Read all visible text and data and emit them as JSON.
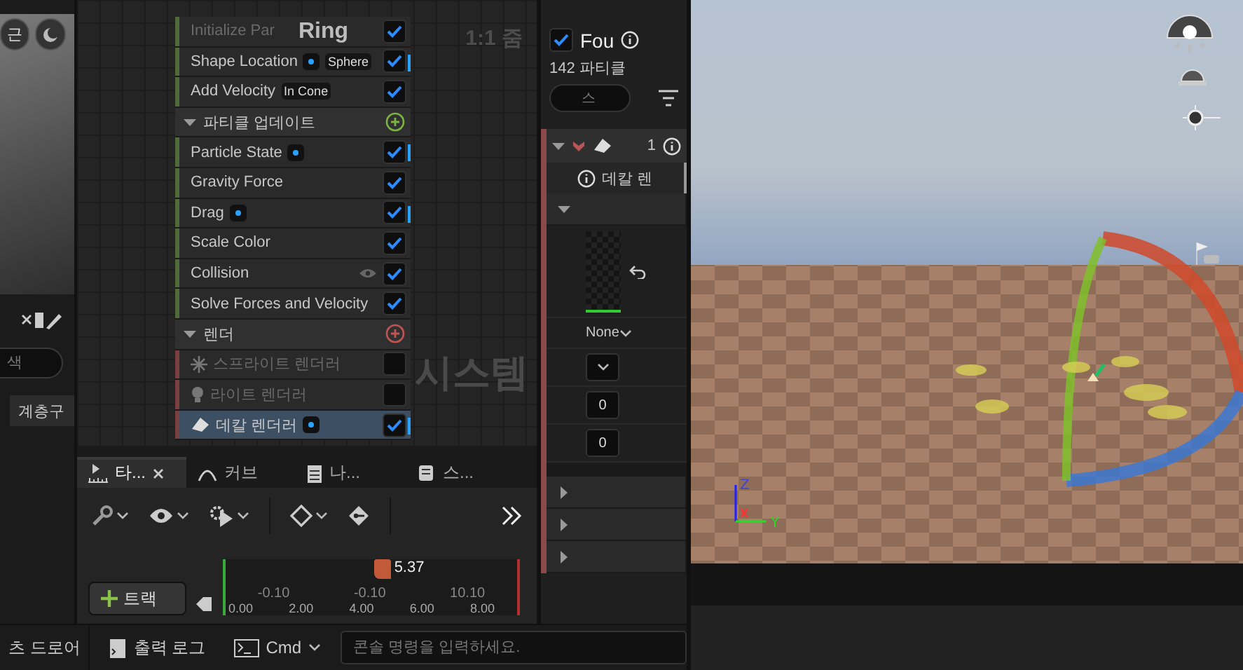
{
  "left_panel": {
    "view_button": "근",
    "search": {
      "placeholder": "색"
    },
    "hierarchy_button": "계층구"
  },
  "graph": {
    "title": "Ring",
    "zoom": "1:1 줌",
    "label": "시스템"
  },
  "module_stack": [
    {
      "kind": "module",
      "label": "Initialize Par",
      "dot": false,
      "checked": true,
      "disabled": true,
      "selected": false,
      "eye": false,
      "bar": false,
      "color": "#4f6b3a"
    },
    {
      "kind": "module",
      "label": "Shape Location",
      "dot": true,
      "tag": "Sphere",
      "checked": true,
      "disabled": false,
      "selected": false,
      "eye": false,
      "bar": true,
      "color": "#4f6b3a"
    },
    {
      "kind": "module",
      "label": "Add Velocity",
      "dot": false,
      "tag": "In Cone",
      "checked": true,
      "disabled": false,
      "selected": false,
      "eye": false,
      "bar": false,
      "color": "#4f6b3a"
    },
    {
      "kind": "header",
      "label": "파티클 업데이트",
      "expanded": true,
      "color": "#7cb342"
    },
    {
      "kind": "module",
      "label": "Particle State",
      "dot": true,
      "checked": true,
      "disabled": false,
      "selected": false,
      "eye": false,
      "bar": true,
      "color": "#4f6b3a"
    },
    {
      "kind": "module",
      "label": "Gravity Force",
      "dot": false,
      "checked": true,
      "disabled": false,
      "selected": false,
      "eye": false,
      "bar": false,
      "color": "#4f6b3a"
    },
    {
      "kind": "module",
      "label": "Drag",
      "dot": true,
      "checked": true,
      "disabled": false,
      "selected": false,
      "eye": false,
      "bar": true,
      "color": "#4f6b3a"
    },
    {
      "kind": "module",
      "label": "Scale Color",
      "dot": false,
      "checked": true,
      "disabled": false,
      "selected": false,
      "eye": false,
      "bar": false,
      "color": "#4f6b3a"
    },
    {
      "kind": "module",
      "label": "Collision",
      "dot": false,
      "checked": true,
      "disabled": false,
      "selected": false,
      "eye": true,
      "bar": false,
      "color": "#4f6b3a"
    },
    {
      "kind": "module",
      "label": "Solve Forces and Velocity",
      "dot": false,
      "checked": true,
      "disabled": false,
      "selected": false,
      "eye": false,
      "bar": false,
      "color": "#4f6b3a"
    },
    {
      "kind": "header",
      "label": "렌더",
      "expanded": true,
      "color": "#c25454"
    },
    {
      "kind": "sprite_renderer",
      "label": "스프라이트 렌더러",
      "dot": false,
      "checked": false,
      "disabled": true,
      "selected": false,
      "eye": false,
      "bar": false,
      "color": "#7a3f3f"
    },
    {
      "kind": "light_renderer",
      "label": "라이트 렌더러",
      "dot": false,
      "checked": false,
      "disabled": true,
      "selected": false,
      "eye": false,
      "bar": false,
      "color": "#7a3f3f"
    },
    {
      "kind": "decal_renderer",
      "label": "데칼 렌더러",
      "dot": true,
      "checked": true,
      "disabled": false,
      "selected": true,
      "eye": false,
      "bar": true,
      "color": "#7a3f3f"
    }
  ],
  "sequencer": {
    "tabs": [
      {
        "kind": "timeline",
        "label": "타...",
        "selected": true,
        "closable": true
      },
      {
        "kind": "curve",
        "label": "커브",
        "selected": false,
        "closable": false
      },
      {
        "kind": "notes",
        "label": "나...",
        "selected": false,
        "closable": false
      },
      {
        "kind": "script",
        "label": "스...",
        "selected": false,
        "closable": false
      }
    ],
    "add_track": "트랙",
    "playhead": "5.37",
    "level": 0.54,
    "range_labels": [
      "-0.10",
      "-0.10",
      "10.10"
    ],
    "ticks": [
      "0.00",
      "2.00",
      "4.00",
      "6.00",
      "8.00"
    ]
  },
  "details": {
    "emitter": {
      "checked": true,
      "name": "Fou",
      "count": "142 파티클"
    },
    "search": {
      "placeholder": "스"
    },
    "renderer": {
      "index": "1",
      "title": "데칼 렌",
      "material": "None",
      "fields": [
        "0",
        "0"
      ]
    },
    "categories": [
      {
        "expanded": true
      },
      {
        "expanded": false
      },
      {
        "expanded": false
      },
      {
        "expanded": false
      }
    ]
  },
  "viewport": {
    "axes": [
      "Z",
      "X",
      "Y"
    ]
  },
  "status_bar": {
    "drawer": "츠 드로어",
    "output_log": "출력 로그",
    "cmd": "Cmd",
    "console_placeholder": "콘솔 명령을 입력하세요."
  }
}
